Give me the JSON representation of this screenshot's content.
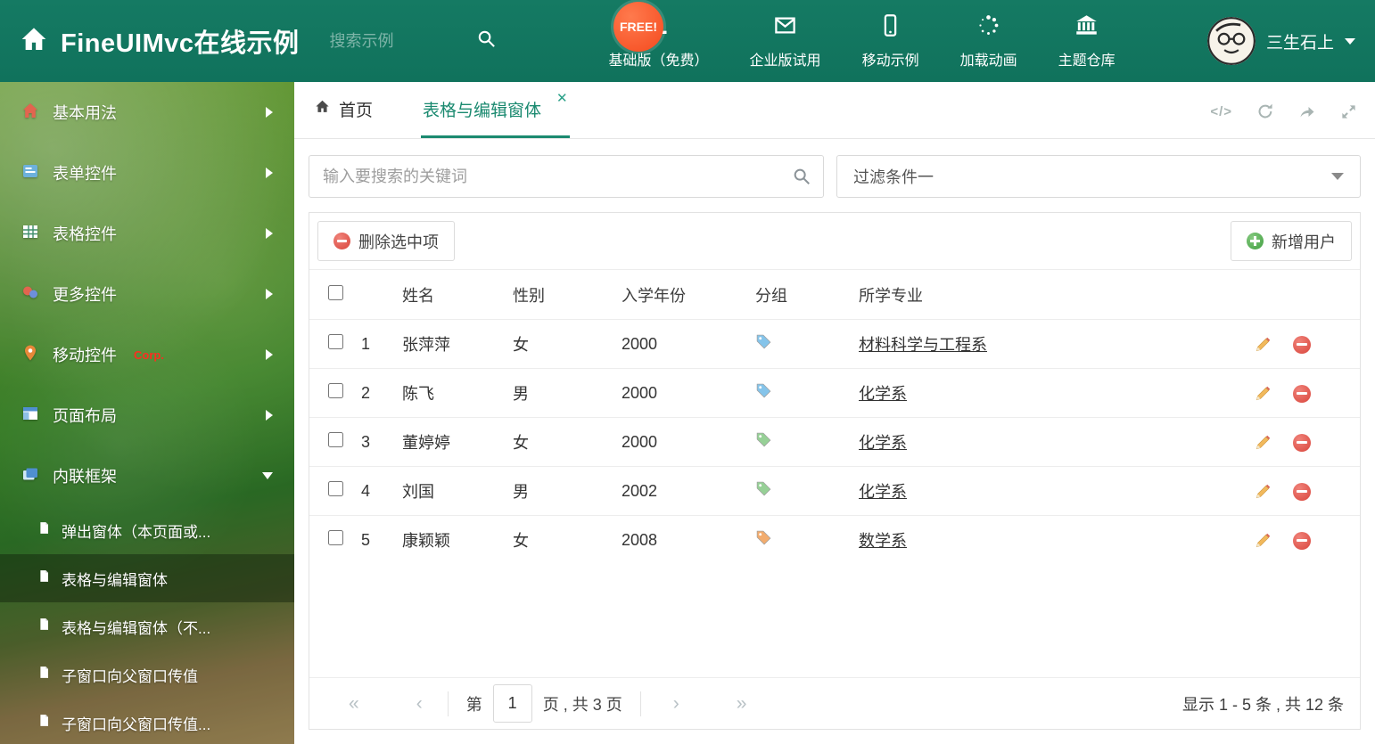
{
  "accent": "#1b8a70",
  "header": {
    "title": "FineUIMvc在线示例",
    "search_placeholder": "搜索示例",
    "free_badge": "FREE!",
    "nav_items": [
      {
        "id": "download",
        "label": "基础版（免费）"
      },
      {
        "id": "envelope",
        "label": "企业版试用"
      },
      {
        "id": "mobile",
        "label": "移动示例"
      },
      {
        "id": "spinner",
        "label": "加载动画"
      },
      {
        "id": "bank",
        "label": "主题仓库"
      }
    ],
    "user_name": "三生石上"
  },
  "sidebar": {
    "items": [
      {
        "id": "home",
        "label": "基本用法",
        "badge": "",
        "state": "collapsed"
      },
      {
        "id": "form",
        "label": "表单控件",
        "badge": "",
        "state": "collapsed"
      },
      {
        "id": "table",
        "label": "表格控件",
        "badge": "",
        "state": "collapsed"
      },
      {
        "id": "more",
        "label": "更多控件",
        "badge": "",
        "state": "collapsed"
      },
      {
        "id": "mobile",
        "label": "移动控件",
        "badge": "Corp.",
        "state": "collapsed"
      },
      {
        "id": "layout",
        "label": "页面布局",
        "badge": "",
        "state": "collapsed"
      },
      {
        "id": "iframe",
        "label": "内联框架",
        "badge": "",
        "state": "expanded"
      }
    ],
    "subitems": [
      {
        "label": "弹出窗体（本页面或...",
        "active": false
      },
      {
        "label": "表格与编辑窗体",
        "active": true
      },
      {
        "label": "表格与编辑窗体（不...",
        "active": false
      },
      {
        "label": "子窗口向父窗口传值",
        "active": false
      },
      {
        "label": "子窗口向父窗口传值...",
        "active": false
      }
    ]
  },
  "tabbar": {
    "home_tab": "首页",
    "active_tab": "表格与编辑窗体",
    "close_glyph": "✕",
    "code_glyph": "</>"
  },
  "filter": {
    "search_placeholder": "输入要搜索的关键词",
    "dropdown_value": "过滤条件一"
  },
  "toolbar": {
    "delete_label": "删除选中项",
    "add_label": "新增用户"
  },
  "table": {
    "columns": [
      "姓名",
      "性别",
      "入学年份",
      "分组",
      "所学专业"
    ],
    "rows": [
      {
        "num": "1",
        "name": "张萍萍",
        "gender": "女",
        "year": "2000",
        "tag_color": "#85c4ea",
        "major": "材料科学与工程系"
      },
      {
        "num": "2",
        "name": "陈飞",
        "gender": "男",
        "year": "2000",
        "tag_color": "#85c4ea",
        "major": "化学系"
      },
      {
        "num": "3",
        "name": "董婷婷",
        "gender": "女",
        "year": "2000",
        "tag_color": "#96d096",
        "major": "化学系"
      },
      {
        "num": "4",
        "name": "刘国",
        "gender": "男",
        "year": "2002",
        "tag_color": "#96d096",
        "major": "化学系"
      },
      {
        "num": "5",
        "name": "康颖颖",
        "gender": "女",
        "year": "2008",
        "tag_color": "#f2ac6e",
        "major": "数学系"
      }
    ]
  },
  "pagination": {
    "icons": {
      "first": "«",
      "prev": "‹",
      "next": "›",
      "last": "»"
    },
    "page_prefix": "第",
    "current_page": "1",
    "page_suffix": "页 , 共 3 页",
    "summary": "显示 1 - 5 条 , 共 12 条"
  }
}
